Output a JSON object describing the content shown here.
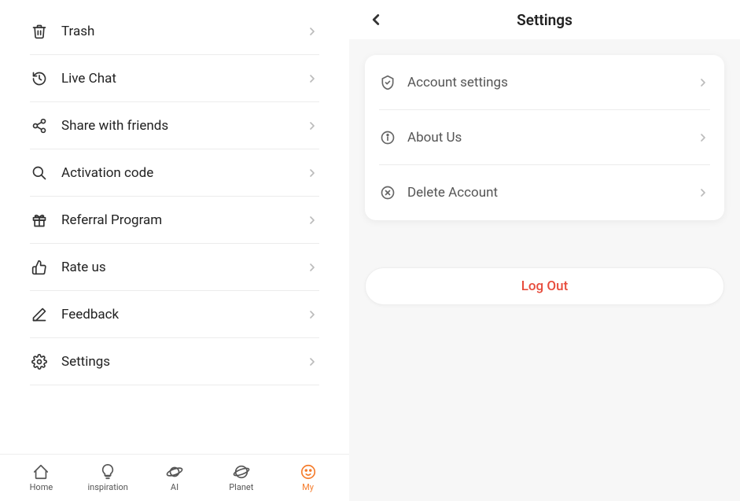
{
  "left_menu": {
    "items": [
      {
        "label": "Trash"
      },
      {
        "label": "Live Chat"
      },
      {
        "label": "Share with friends"
      },
      {
        "label": "Activation code"
      },
      {
        "label": "Referral Program"
      },
      {
        "label": "Rate us"
      },
      {
        "label": "Feedback"
      },
      {
        "label": "Settings"
      }
    ]
  },
  "bottom_nav": {
    "items": [
      {
        "label": "Home"
      },
      {
        "label": "inspiration"
      },
      {
        "label": "AI"
      },
      {
        "label": "Planet"
      },
      {
        "label": "My"
      }
    ],
    "active_index": 4
  },
  "right_panel": {
    "title": "Settings",
    "card_items": [
      {
        "label": "Account settings"
      },
      {
        "label": "About Us"
      },
      {
        "label": "Delete Account"
      }
    ],
    "logout_label": "Log Out"
  }
}
